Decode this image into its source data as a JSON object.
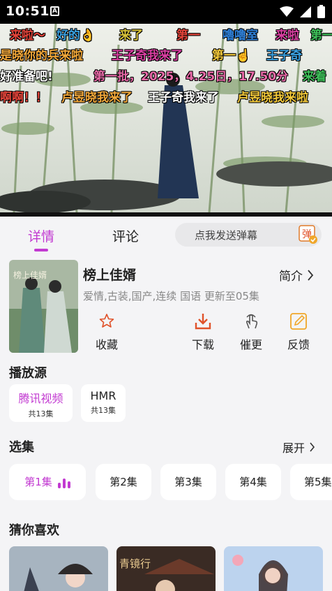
{
  "status_bar": {
    "time": "10:51",
    "a_icon": "A"
  },
  "danmaku": [
    {
      "text": "来啦～",
      "color": "#e4443a"
    },
    {
      "text": "好的👌",
      "color": "#3aa0e0"
    },
    {
      "text": "来了",
      "color": "#d8c23a"
    },
    {
      "text": "第一",
      "color": "#e4443a"
    },
    {
      "text": "嚕嚕室",
      "color": "#2f80d8"
    },
    {
      "text": "来啦",
      "color": "#d93fa2"
    },
    {
      "text": "第一",
      "color": "#3ec15a"
    },
    {
      "text": "是晓你的兵来啦",
      "color": "#f2a83a"
    },
    {
      "text": "王子奇我来了",
      "color": "#d93fa2"
    },
    {
      "text": "第一☝️",
      "color": "#f3c93a"
    },
    {
      "text": "王子奇",
      "color": "#3aa0e0"
    },
    {
      "text": "好准备吧!",
      "color": "#ffffff"
    },
    {
      "text": "第一批，2025，4.25日，17.50分",
      "color": "#e86aa8"
    },
    {
      "text": "来着",
      "color": "#3ec15a"
    },
    {
      "text": "啊啊！！",
      "color": "#e4443a"
    },
    {
      "text": "卢昱晓我来了",
      "color": "#f2a83a"
    },
    {
      "text": "王子奇我来了",
      "color": "#ffffff"
    },
    {
      "text": "卢昱晓我来啦",
      "color": "#f3c93a"
    }
  ],
  "tabs": {
    "details": "详情",
    "comments": "评论"
  },
  "danmaku_input": {
    "placeholder": "点我发送弹幕",
    "button": "弹"
  },
  "show": {
    "title": "榜上佳婿",
    "intro_label": "简介",
    "meta": "爱情,古装,国产,连续 国语 更新至05集",
    "poster_text": "榜上佳婿"
  },
  "actions": {
    "favorite": "收藏",
    "download": "下载",
    "urge": "催更",
    "feedback": "反馈"
  },
  "sources": {
    "title": "播放源",
    "items": [
      {
        "name": "腾讯视频",
        "count": "共13集"
      },
      {
        "name": "HMR",
        "count": "共13集"
      }
    ]
  },
  "episodes": {
    "title": "选集",
    "expand": "展开",
    "items": [
      "第1集",
      "第2集",
      "第3集",
      "第4集",
      "第5集"
    ]
  },
  "recommend": {
    "title": "猜你喜欢",
    "card2_text": "青镜行"
  },
  "colors": {
    "accent": "#c23ad1",
    "danmaku_badge": "#f0a72a"
  }
}
